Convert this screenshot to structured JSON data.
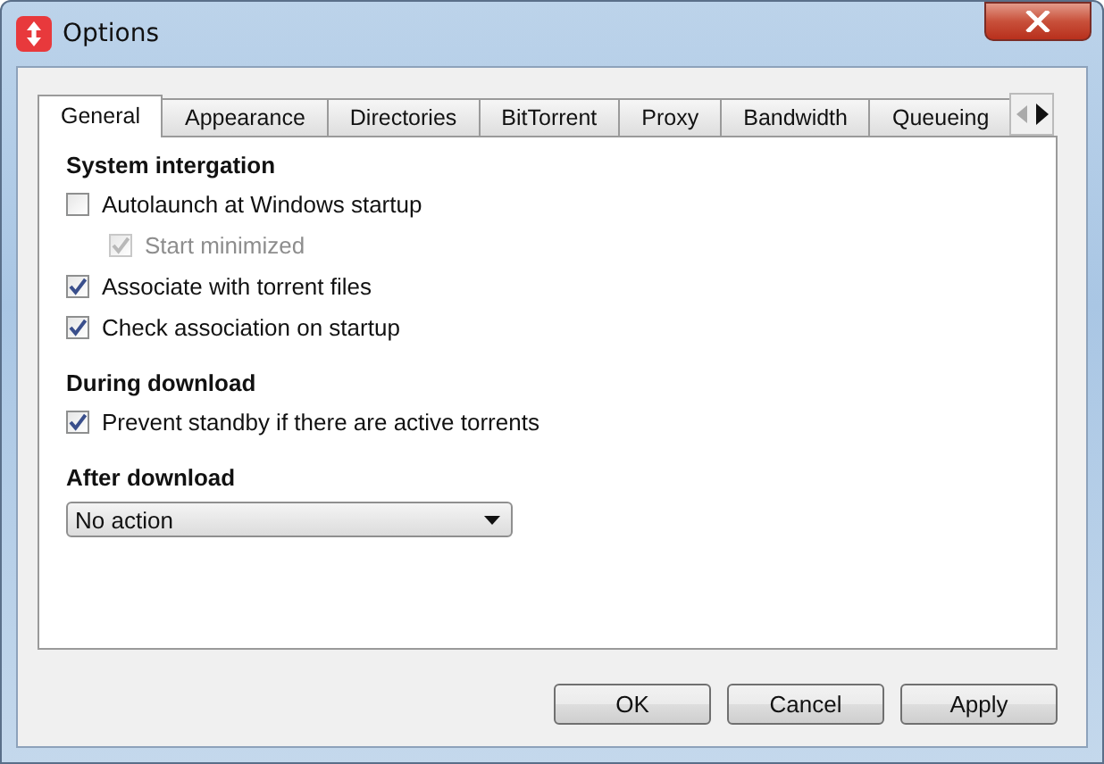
{
  "window": {
    "title": "Options"
  },
  "tabs": [
    {
      "label": "General",
      "selected": true
    },
    {
      "label": "Appearance",
      "selected": false
    },
    {
      "label": "Directories",
      "selected": false
    },
    {
      "label": "BitTorrent",
      "selected": false
    },
    {
      "label": "Proxy",
      "selected": false
    },
    {
      "label": "Bandwidth",
      "selected": false
    },
    {
      "label": "Queueing",
      "selected": false
    }
  ],
  "sections": [
    {
      "heading": "System intergation",
      "items": [
        {
          "kind": "checkbox",
          "label": "Autolaunch at Windows startup",
          "checked": false,
          "disabled": false,
          "children": [
            {
              "kind": "checkbox",
              "label": "Start minimized",
              "checked": true,
              "disabled": true
            }
          ]
        },
        {
          "kind": "checkbox",
          "label": "Associate with torrent files",
          "checked": true,
          "disabled": false
        },
        {
          "kind": "checkbox",
          "label": "Check association on startup",
          "checked": true,
          "disabled": false
        }
      ]
    },
    {
      "heading": "During download",
      "items": [
        {
          "kind": "checkbox",
          "label": "Prevent standby if there are active torrents",
          "checked": true,
          "disabled": false
        }
      ]
    },
    {
      "heading": "After download",
      "items": [
        {
          "kind": "dropdown",
          "value": "No action"
        }
      ]
    }
  ],
  "buttons": [
    "OK",
    "Cancel",
    "Apply"
  ]
}
